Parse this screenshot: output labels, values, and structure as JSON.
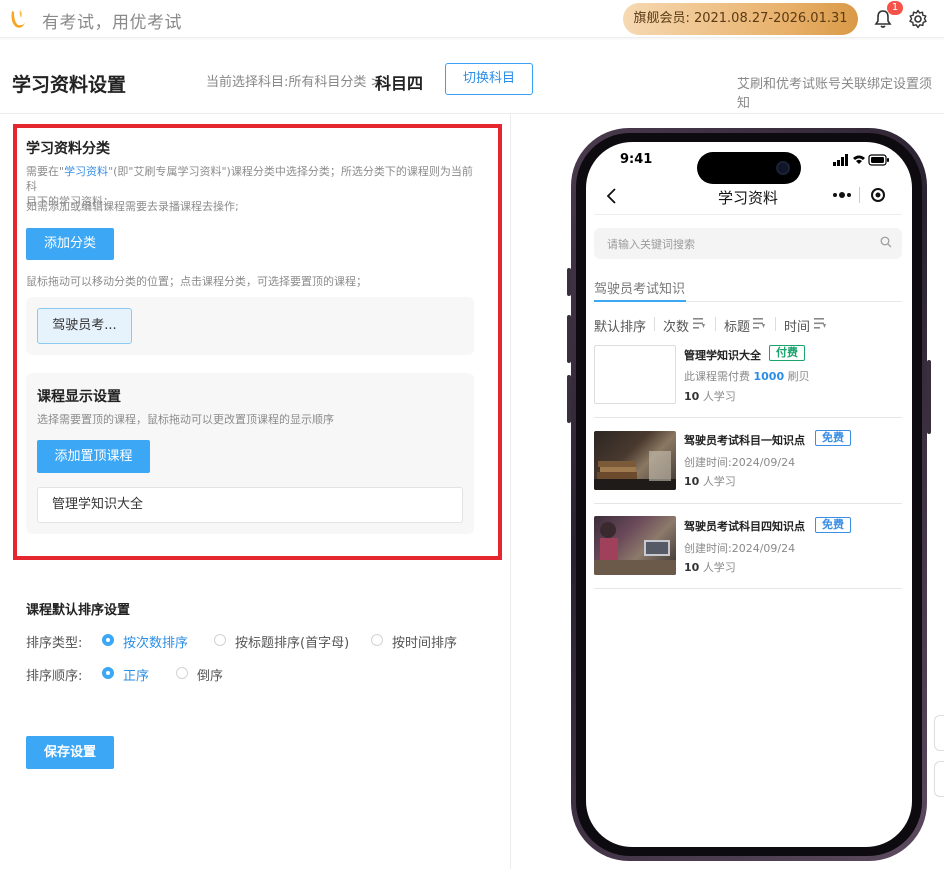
{
  "topbar": {
    "slogan": "有考试，用优考试",
    "vip": "旗舰会员:  2021.08.27-2026.01.31",
    "bell_badge": "1"
  },
  "header": {
    "title": "学习资料设置",
    "breadcrumb": "当前选择科目:所有科目分类 >",
    "current_subject": "科目四",
    "switch_label": "切换科目",
    "notice_link": "艾刷和优考试账号关联绑定设置须知"
  },
  "category": {
    "title": "学习资料分类",
    "hint1_a": "需要在\"",
    "hint1_link": "学习资料",
    "hint1_b": "\"(即\"艾刷专属学习资料\")课程分类中选择分类；所选分类下的课程则为当前科",
    "hint1_c": "目下的学习资料；",
    "hint2": "如需添加或编辑课程需要去录播课程去操作;",
    "add_label": "添加分类",
    "drag_hint": "鼠标拖动可以移动分类的位置；点击课程分类，可选择要置顶的课程；",
    "chip": "驾驶员考..."
  },
  "display": {
    "title": "课程显示设置",
    "hint": "选择需要置顶的课程，鼠标拖动可以更改置顶课程的显示顺序",
    "add_label": "添加置顶课程",
    "top_course": "管理学知识大全"
  },
  "sort_settings": {
    "title": "课程默认排序设置",
    "type_label": "排序类型:",
    "type_options": [
      {
        "label": "按次数排序",
        "selected": true
      },
      {
        "label": "按标题排序(首字母)",
        "selected": false
      },
      {
        "label": "按时间排序",
        "selected": false
      }
    ],
    "order_label": "排序顺序:",
    "order_options": [
      {
        "label": "正序",
        "selected": true
      },
      {
        "label": "倒序",
        "selected": false
      }
    ],
    "save_label": "保存设置"
  },
  "phone": {
    "time": "9:41",
    "nav_title": "学习资料",
    "search_placeholder": "请输入关键词搜索",
    "tab": "驾驶员考试知识",
    "sorts": [
      "默认排序",
      "次数",
      "标题",
      "时间"
    ],
    "courses": [
      {
        "title": "管理学知识大全",
        "tag": "付费",
        "tag_color": "#1aa36b",
        "sub_prefix": "此课程需付费",
        "price": "1000",
        "sub_suffix": "刷贝",
        "learners": "10",
        "learn_suffix": "人学习"
      },
      {
        "title": "驾驶员考试科目一知识点",
        "tag": "免费",
        "tag_color": "#3a8ee6",
        "sub": "创建时间:2024/09/24",
        "learners": "10",
        "learn_suffix": "人学习"
      },
      {
        "title": "驾驶员考试科目四知识点",
        "tag": "免费",
        "tag_color": "#3a8ee6",
        "sub": "创建时间:2024/09/24",
        "learners": "10",
        "learn_suffix": "人学习"
      }
    ]
  },
  "colors": {
    "accent": "#3ba7f5",
    "highlight_border": "#e6262f",
    "vip_gold": "#e8b06a"
  }
}
